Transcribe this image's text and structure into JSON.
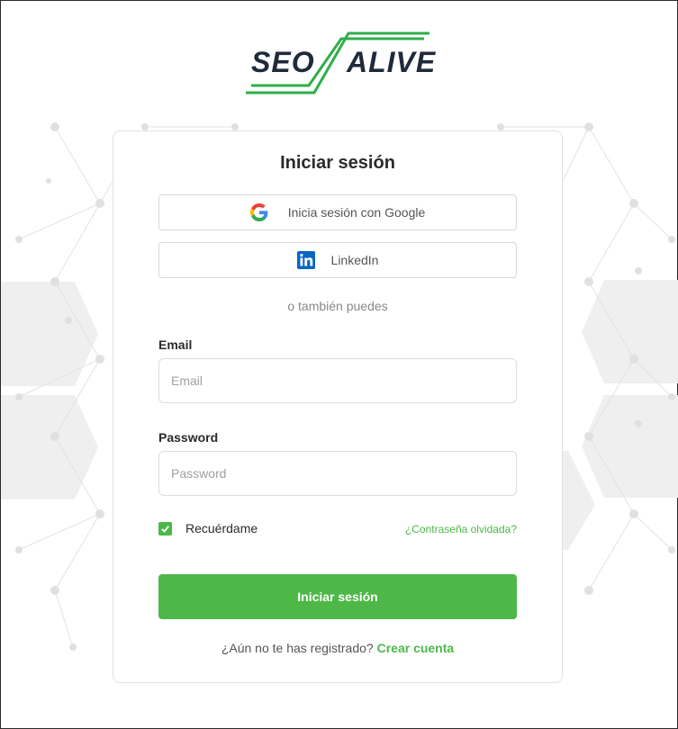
{
  "brand": {
    "left_text": "SEO",
    "right_text": "ALIVE",
    "green": "#2fae49",
    "dark": "#1f2a3a"
  },
  "card": {
    "title": "Iniciar sesión",
    "google_label": "Inicia sesión con Google",
    "linkedin_label": "LinkedIn",
    "alt_text": "o también puedes",
    "email_label": "Email",
    "email_placeholder": "Email",
    "password_label": "Password",
    "password_placeholder": "Password",
    "remember_label": "Recuérdame",
    "remember_checked": true,
    "forgot_label": "¿Contraseña olvidada?",
    "submit_label": "Iniciar sesión",
    "register_prompt": "¿Aún no te has registrado?",
    "register_link": "Crear cuenta"
  },
  "colors": {
    "accent": "#4db848",
    "linkedin": "#0a66c2"
  },
  "icons": {
    "google": "google-icon",
    "linkedin": "linkedin-icon",
    "check": "check-icon"
  }
}
